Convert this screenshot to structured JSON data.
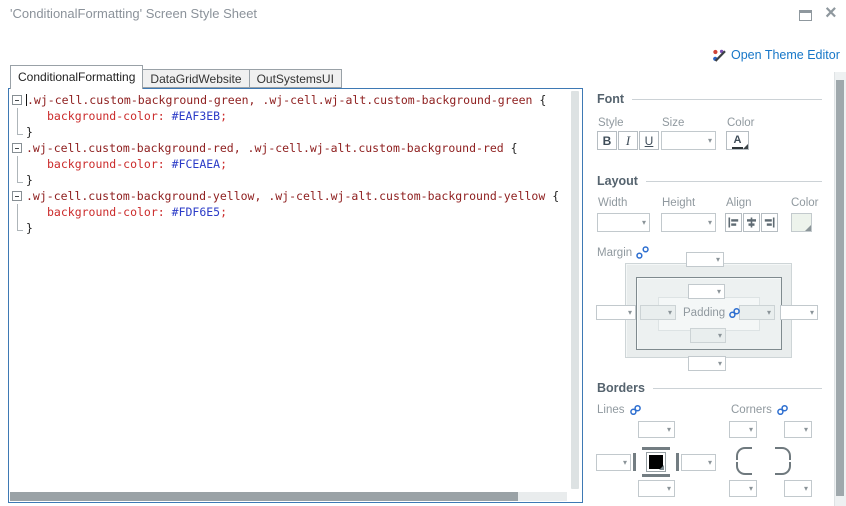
{
  "window": {
    "title": "'ConditionalFormatting' Screen Style Sheet",
    "controls": {
      "close_glyph": "×"
    }
  },
  "toolbar": {
    "open_theme_editor_label": "Open Theme Editor"
  },
  "tabs": [
    {
      "label": "ConditionalFormatting",
      "active": true
    },
    {
      "label": "DataGridWebsite",
      "active": false
    },
    {
      "label": "OutSystemsUI",
      "active": false
    }
  ],
  "editor": {
    "language": "css",
    "rules": [
      {
        "selector": ".wj-cell.custom-background-green, .wj-cell.wj-alt.custom-background-green",
        "open_brace": "{",
        "property": "background-color:",
        "value": "#EAF3EB",
        "semicolon": ";",
        "close_brace": "}"
      },
      {
        "selector": ".wj-cell.custom-background-red, .wj-cell.wj-alt.custom-background-red",
        "open_brace": "{",
        "property": "background-color:",
        "value": "#FCEAEA",
        "semicolon": ";",
        "close_brace": "}"
      },
      {
        "selector": ".wj-cell.custom-background-yellow, .wj-cell.wj-alt.custom-background-yellow",
        "open_brace": "{",
        "property": "background-color:",
        "value": "#FDF6E5",
        "semicolon": ";",
        "close_brace": "}"
      }
    ]
  },
  "panel": {
    "font": {
      "title": "Font",
      "style_label": "Style",
      "size_label": "Size",
      "color_label": "Color",
      "bold_label": "B",
      "italic_label": "I",
      "underline_label": "U",
      "font_color_glyph": "A"
    },
    "layout": {
      "title": "Layout",
      "width_label": "Width",
      "height_label": "Height",
      "align_label": "Align",
      "color_label": "Color"
    },
    "spacing": {
      "margin_label": "Margin",
      "padding_label": "Padding"
    },
    "borders": {
      "title": "Borders",
      "lines_label": "Lines",
      "corners_label": "Corners"
    }
  },
  "icons": {
    "open_theme_editor": "palette-pen-icon",
    "margin_link": "broken-chain-icon",
    "padding_link": "chain-icon",
    "lines_link": "chain-icon",
    "corners_link": "chain-icon",
    "dropdown_arrow": "▾"
  },
  "colors": {
    "link_blue": "#1777c8",
    "editor_focus_border": "#3e79b4",
    "code_selector": "#8f2020",
    "code_property": "#cb2b2b",
    "code_value": "#2b3bc7",
    "green_rule_value": "#EAF3EB",
    "red_rule_value": "#FCEAEA",
    "yellow_rule_value": "#FDF6E5"
  }
}
